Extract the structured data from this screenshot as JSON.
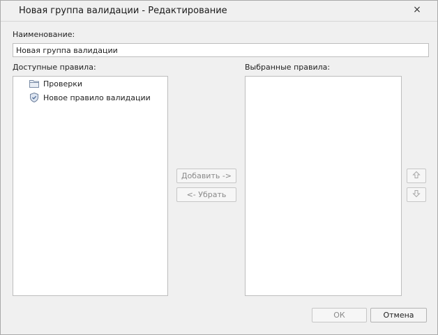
{
  "dialog": {
    "title": "Новая группа валидации - Редактирование",
    "close_glyph": "×"
  },
  "name_field": {
    "label": "Наименование:",
    "value": "Новая группа валидации"
  },
  "available": {
    "label": "Доступные правила:",
    "items": [
      {
        "label": "Проверки",
        "icon": "folder-icon"
      },
      {
        "label": "Новое правило валидации",
        "icon": "validation-rule-icon"
      }
    ]
  },
  "selected": {
    "label": "Выбранные правила:",
    "items": []
  },
  "transfer": {
    "add_label": "Добавить ->",
    "remove_label": "<- Убрать"
  },
  "order": {
    "up_icon": "arrow-up-icon",
    "down_icon": "arrow-down-icon"
  },
  "footer": {
    "ok_label": "ОК",
    "cancel_label": "Отмена"
  }
}
